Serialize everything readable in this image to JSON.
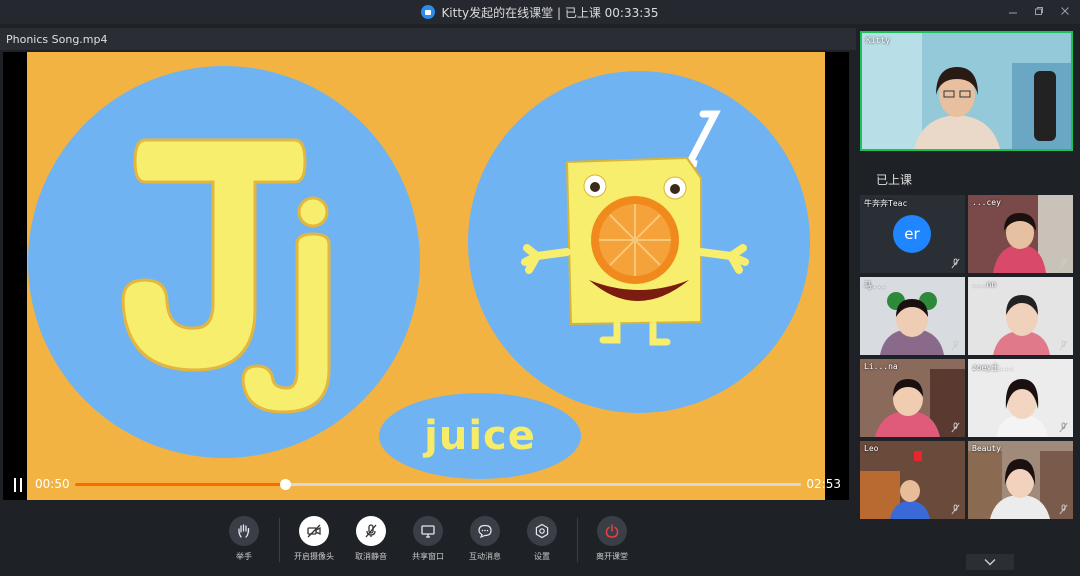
{
  "window": {
    "title": "Kitty发起的在线课堂 | 已上课 00:33:35",
    "controls": [
      "minimize-icon",
      "restore-icon",
      "close-icon"
    ]
  },
  "player": {
    "file_name": "Phonics Song.mp4",
    "current_time": "00:50",
    "total_time": "02:53",
    "progress": 0.289,
    "word": "juice",
    "letters": "Jj"
  },
  "toolbar": {
    "items": [
      {
        "label": "举手",
        "icon": "raise-hand-icon"
      },
      {
        "label": "开启摄像头",
        "icon": "camera-off-icon"
      },
      {
        "label": "取消静音",
        "icon": "mic-off-icon"
      },
      {
        "label": "共享窗口",
        "icon": "share-screen-icon"
      },
      {
        "label": "互动消息",
        "icon": "chat-icon"
      },
      {
        "label": "设置",
        "icon": "gear-icon"
      },
      {
        "label": "离开课堂",
        "icon": "power-icon"
      }
    ]
  },
  "sidebar": {
    "teacher_name": "Kitty",
    "section_label": "已上课",
    "participants": [
      {
        "name": "牛奔奔Teac",
        "avatar": "er"
      },
      {
        "name": "...cey"
      },
      {
        "name": "马..."
      },
      {
        "name": "...nn"
      },
      {
        "name": "Li...na"
      },
      {
        "name": "zoey土..."
      },
      {
        "name": "Leo"
      },
      {
        "name": "Beauty"
      }
    ]
  },
  "colors": {
    "accent_green": "#1fbf5a",
    "progress_orange": "#ff6a00",
    "avatar_blue": "#1f86ff",
    "leave_red": "#e8413b"
  }
}
